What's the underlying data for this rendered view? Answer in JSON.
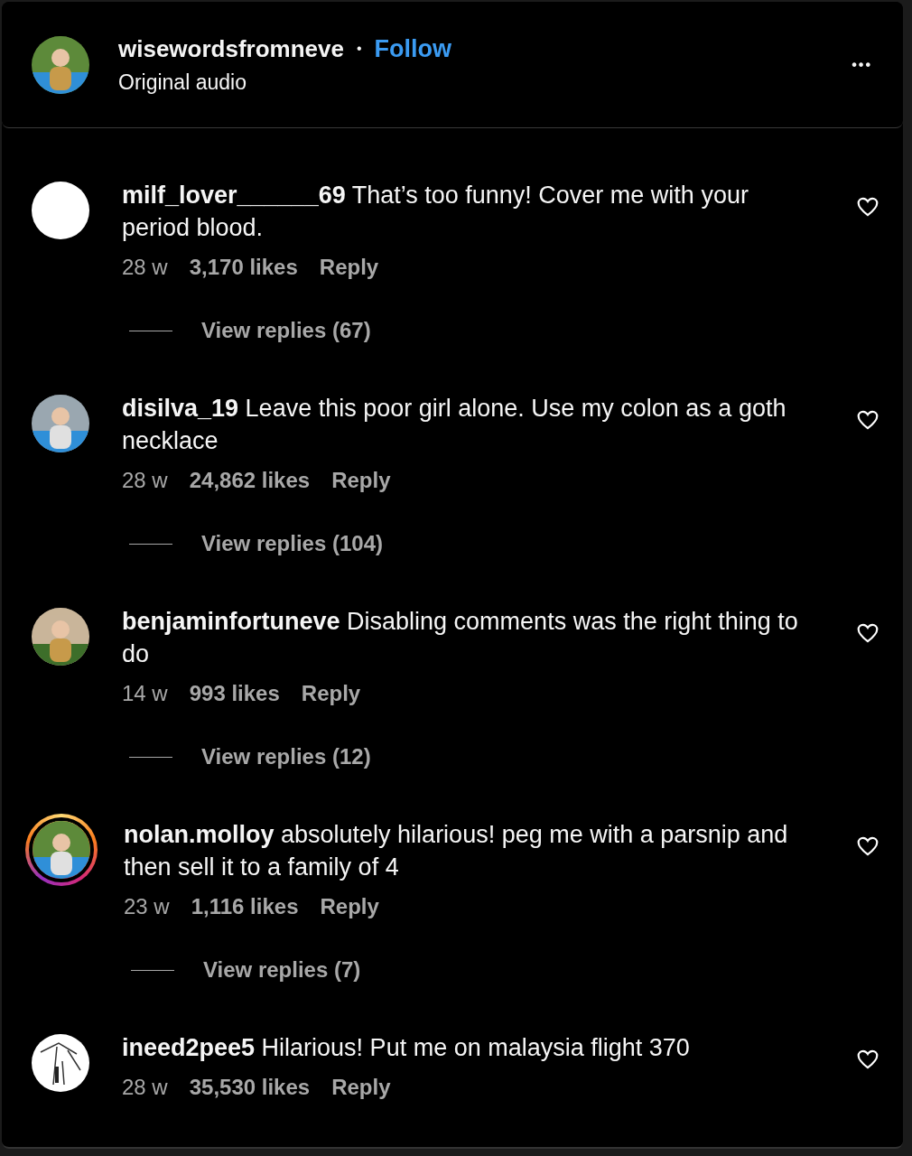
{
  "header": {
    "username": "wisewordsfromneve",
    "separator": "•",
    "follow": "Follow",
    "subtitle": "Original audio",
    "more": "•••"
  },
  "comments": [
    {
      "kind": "blank",
      "story": false,
      "username": "milf_lover______69",
      "text": "That’s too funny! Cover me with your period blood.",
      "time": "28 w",
      "likes": "3,170 likes",
      "reply": "Reply",
      "replies": "View replies (67)"
    },
    {
      "kind": "picture",
      "story": false,
      "username": "disilva_19",
      "text": "Leave this poor girl alone. Use my colon as a goth necklace",
      "time": "28 w",
      "likes": "24,862 likes",
      "reply": "Reply",
      "replies": "View replies (104)"
    },
    {
      "kind": "picture",
      "story": false,
      "username": "benjaminfortuneve",
      "text": "Disabling comments was the right thing to do",
      "time": "14 w",
      "likes": "993 likes",
      "reply": "Reply",
      "replies": "View replies (12)"
    },
    {
      "kind": "picture",
      "story": true,
      "username": "nolan.molloy",
      "text": "absolutely hilarious! peg me with a parsnip and then sell it to a family of 4",
      "time": "23 w",
      "likes": "1,116 likes",
      "reply": "Reply",
      "replies": "View replies (7)"
    },
    {
      "kind": "sketch",
      "story": false,
      "username": "ineed2pee5",
      "text": "Hilarious! Put me on malaysia flight 370",
      "time": "28 w",
      "likes": "35,530 likes",
      "reply": "Reply"
    }
  ]
}
